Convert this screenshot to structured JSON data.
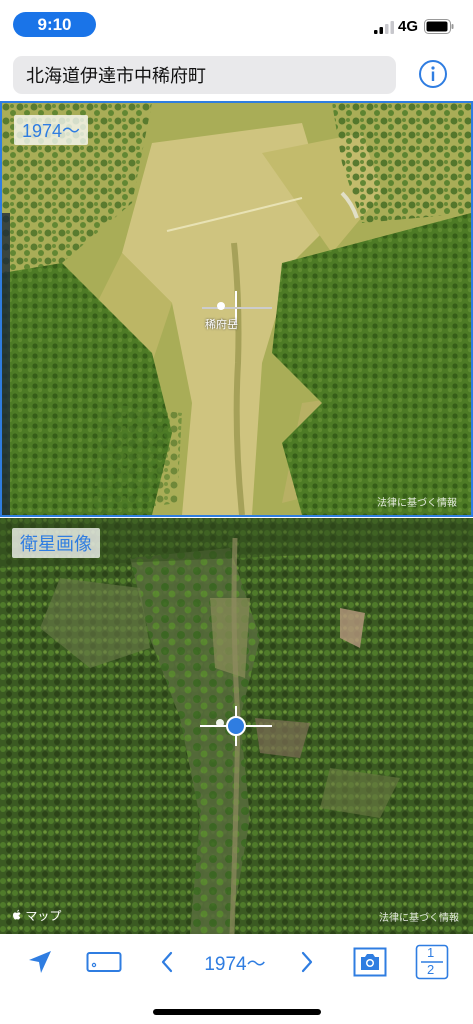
{
  "status": {
    "time": "9:10",
    "network": "4G"
  },
  "search": {
    "value": "北海道伊達市中稀府町"
  },
  "top_map": {
    "era_label": "1974〜",
    "place_label": "稀府岳",
    "legal": "法律に基づく情報"
  },
  "bottom_map": {
    "era_label": "衛星画像",
    "attribution": "マップ",
    "legal": "法律に基づく情報"
  },
  "toolbar": {
    "year_label": "1974〜",
    "page_top": "1",
    "page_bottom": "2"
  },
  "colors": {
    "accent": "#2f7de1",
    "status_pill": "#1a74e8"
  },
  "icons": [
    "location-arrow-icon",
    "ticket-icon",
    "chevron-left-icon",
    "chevron-right-icon",
    "camera-icon",
    "page-indicator-icon",
    "info-icon"
  ]
}
